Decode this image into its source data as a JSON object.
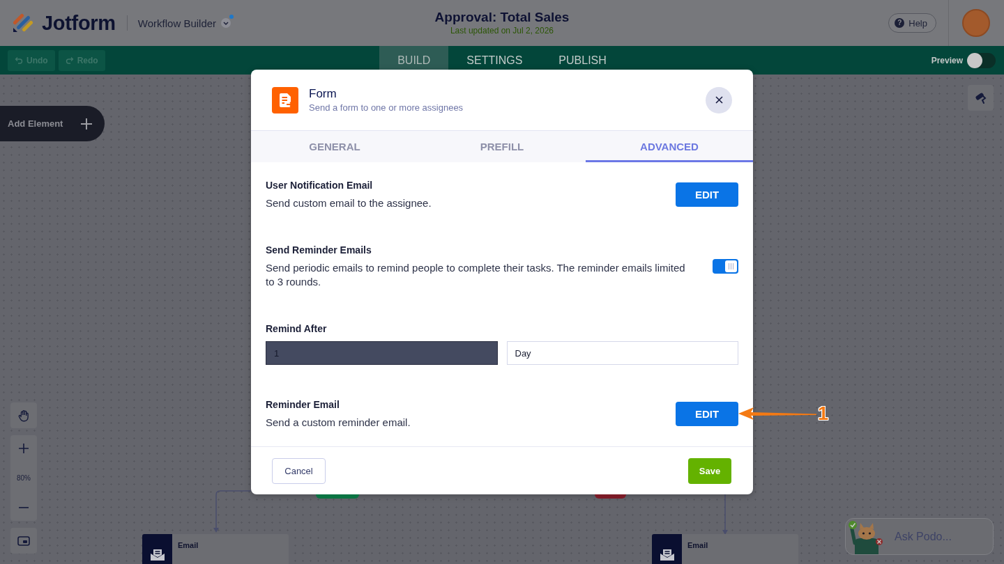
{
  "header": {
    "logo": "Jotform",
    "product": "Workflow Builder",
    "title": "Approval: Total Sales",
    "updated": "Last updated on Jul 2, 2026",
    "help_icon": "?",
    "help": "Help"
  },
  "toolbar": {
    "undo": "Undo",
    "redo": "Redo",
    "tabs": [
      {
        "label": "BUILD",
        "selected": true
      },
      {
        "label": "SETTINGS",
        "selected": false
      },
      {
        "label": "PUBLISH",
        "selected": false
      }
    ],
    "preview": {
      "label": "Preview",
      "on": false
    }
  },
  "canvas": {
    "add_element": "Add Element",
    "zoom_level": "80%",
    "branch_tags": [
      {
        "color": "#0b7443"
      },
      {
        "color": "#7c1b27"
      }
    ],
    "nodes": [
      {
        "title": "Email"
      },
      {
        "title": "Email"
      }
    ],
    "assistant": "Ask Podo..."
  },
  "modal": {
    "title": "Form",
    "subtitle": "Send a form to one or more assignees",
    "tabs": [
      {
        "label": "GENERAL",
        "selected": false
      },
      {
        "label": "PREFILL",
        "selected": false
      },
      {
        "label": "ADVANCED",
        "selected": true
      }
    ],
    "sections": [
      {
        "kind": "button",
        "title": "User Notification Email",
        "description": "Send custom email to the assignee.",
        "button": "EDIT"
      },
      {
        "kind": "toggle",
        "title": "Send Reminder Emails",
        "description": "Send periodic emails to remind people to complete their tasks. The reminder emails limited to 3 rounds.",
        "on": true
      },
      {
        "kind": "fields",
        "title": "Remind After",
        "value": "1",
        "unit": "Day"
      },
      {
        "kind": "button",
        "title": "Reminder Email",
        "description": "Send a custom reminder email.",
        "button": "EDIT"
      }
    ],
    "cancel": "Cancel",
    "save": "Save"
  },
  "annotation": {
    "label": "1"
  }
}
